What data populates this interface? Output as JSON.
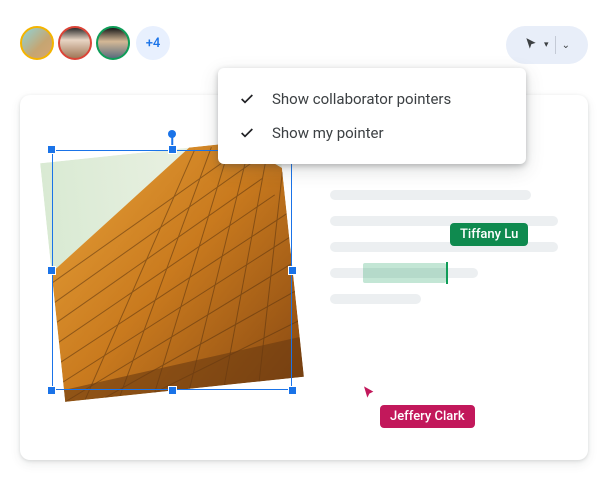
{
  "collaborators": {
    "avatars": [
      "user-1",
      "user-2",
      "user-3"
    ],
    "more_count": "+4"
  },
  "pointer_button": {
    "icon": "cursor-icon"
  },
  "menu": {
    "items": [
      {
        "label": "Show collaborator pointers",
        "checked": true
      },
      {
        "label": "Show my pointer",
        "checked": true
      }
    ]
  },
  "remote_users": {
    "tiffany": {
      "name": "Tiffany Lu",
      "color": "#0f8a4f"
    },
    "jeffery": {
      "name": "Jeffery Clark",
      "color": "#c2185b"
    }
  }
}
